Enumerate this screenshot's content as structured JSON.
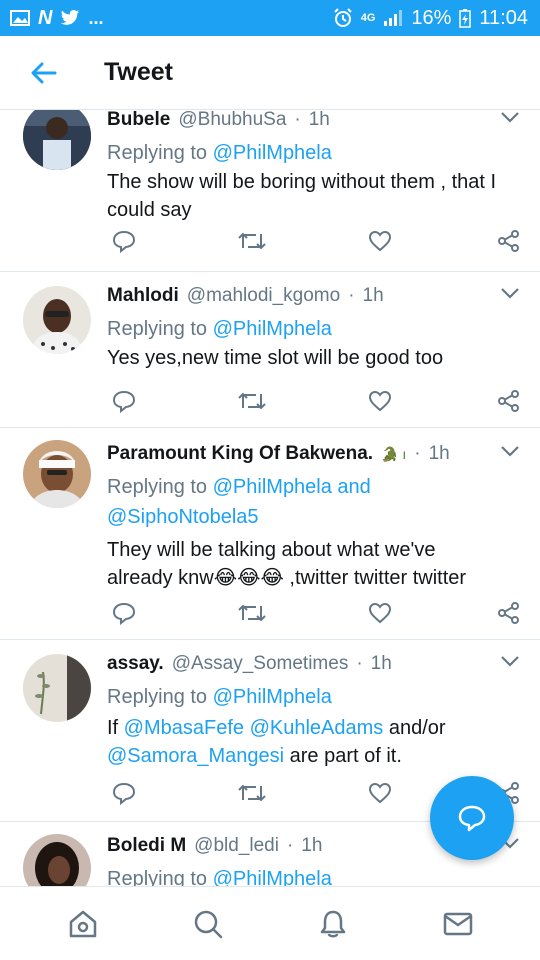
{
  "status_bar": {
    "notifications": [
      "N",
      "twitter-bird",
      "..."
    ],
    "network": "4G",
    "battery": "16%",
    "time": "11:04"
  },
  "header": {
    "title": "Tweet"
  },
  "colors": {
    "accent": "#1da1f2",
    "secondary_text": "#657786",
    "divider": "#e1e8ed"
  },
  "tweets": [
    {
      "name": "Bubele",
      "handle": "@BhubhuSa",
      "time": "1h",
      "replying_prefix": "Replying to ",
      "replying_to": "@PhilMphela",
      "text": "The show will be boring without them , that I could say"
    },
    {
      "name": "Mahlodi",
      "handle": "@mahlodi_kgomo",
      "time": "1h",
      "replying_prefix": "Replying to ",
      "replying_to": "@PhilMphela",
      "text": "Yes yes,new time slot will be good too"
    },
    {
      "name": "Paramount King Of Bakwena.",
      "handle": "🐊 ı",
      "time": "1h",
      "replying_prefix": "Replying to ",
      "replying_to": "@PhilMphela and",
      "replying_to_2": "@SiphoNtobela5",
      "text_line1": "They will be talking about what we've",
      "text_line2_a": "already knw",
      "text_emoji": "😂😂😂",
      "text_line2_b": " ,twitter twitter twitter"
    },
    {
      "name": "assay.",
      "handle": "@Assay_Sometimes",
      "time": "1h",
      "replying_prefix": "Replying to ",
      "replying_to": "@PhilMphela",
      "text_if": "If ",
      "mention_1": "@MbasaFefe",
      "mention_2": "@KuhleAdams",
      "text_andor": " and/or",
      "mention_3": "@Samora_Mangesi",
      "text_end": " are part of it."
    },
    {
      "name": "Boledi M",
      "handle": "@bld_ledi",
      "time": "1h",
      "replying_prefix": "Replying to ",
      "replying_to": "@PhilMphela"
    }
  ],
  "separator": "·",
  "icons": {
    "back": "arrow-left-icon",
    "caret": "chevron-down-icon",
    "reply": "reply-icon",
    "retweet": "retweet-icon",
    "like": "heart-icon",
    "share": "share-icon",
    "compose": "compose-tweet-icon",
    "home": "home-icon",
    "search": "search-icon",
    "notifications": "bell-icon",
    "messages": "mail-icon"
  }
}
